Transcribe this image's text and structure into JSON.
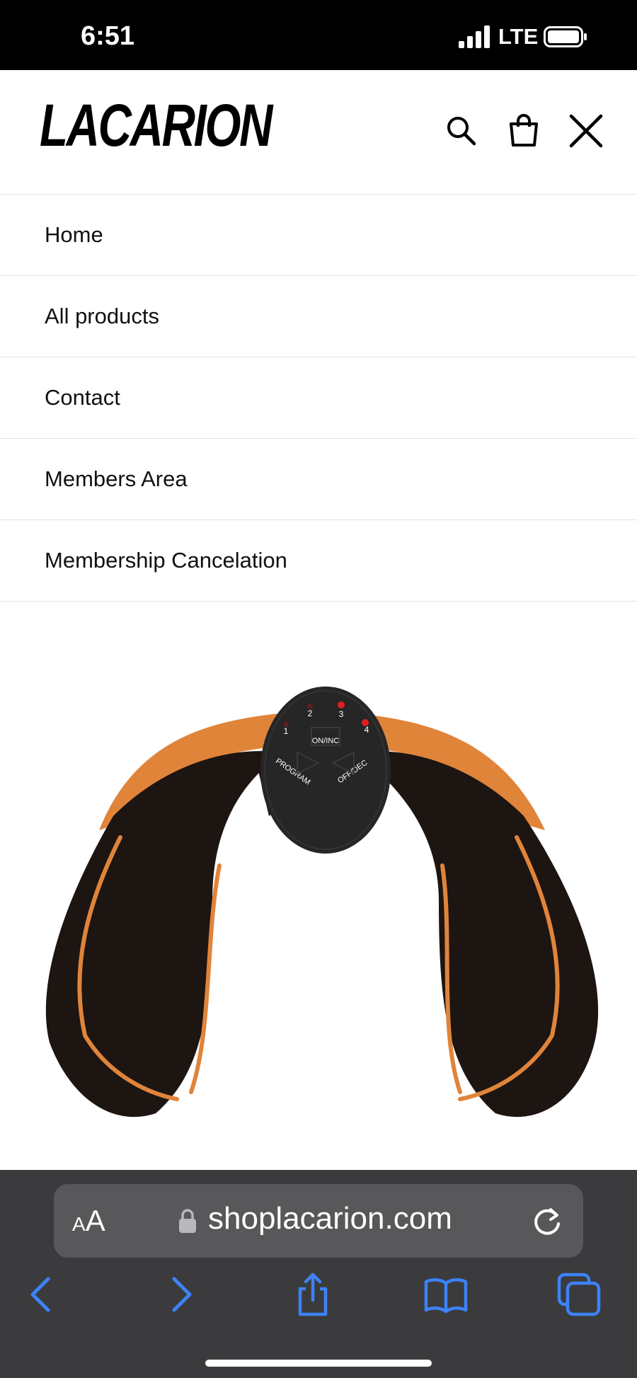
{
  "status": {
    "time": "6:51",
    "network": "LTE"
  },
  "header": {
    "logo": "LACARION"
  },
  "menu": [
    {
      "label": "Home"
    },
    {
      "label": "All products"
    },
    {
      "label": "Contact"
    },
    {
      "label": "Members Area"
    },
    {
      "label": "Membership Cancelation"
    }
  ],
  "product": {
    "device_labels": {
      "l1": "1",
      "l2": "2",
      "l3": "3",
      "l4": "4",
      "on": "ON/INC",
      "program": "PROGRAM",
      "off": "OFF/DEC"
    },
    "colors": {
      "pad": "#1c1512",
      "accent": "#e0843a",
      "controller": "#262626"
    }
  },
  "browser": {
    "aa_small": "A",
    "aa_large": "A",
    "url": "shoplacarion.com"
  },
  "colors": {
    "ios_blue": "#3d82f7",
    "browser_bg": "#3b3b3d",
    "url_bg": "#58585b"
  }
}
